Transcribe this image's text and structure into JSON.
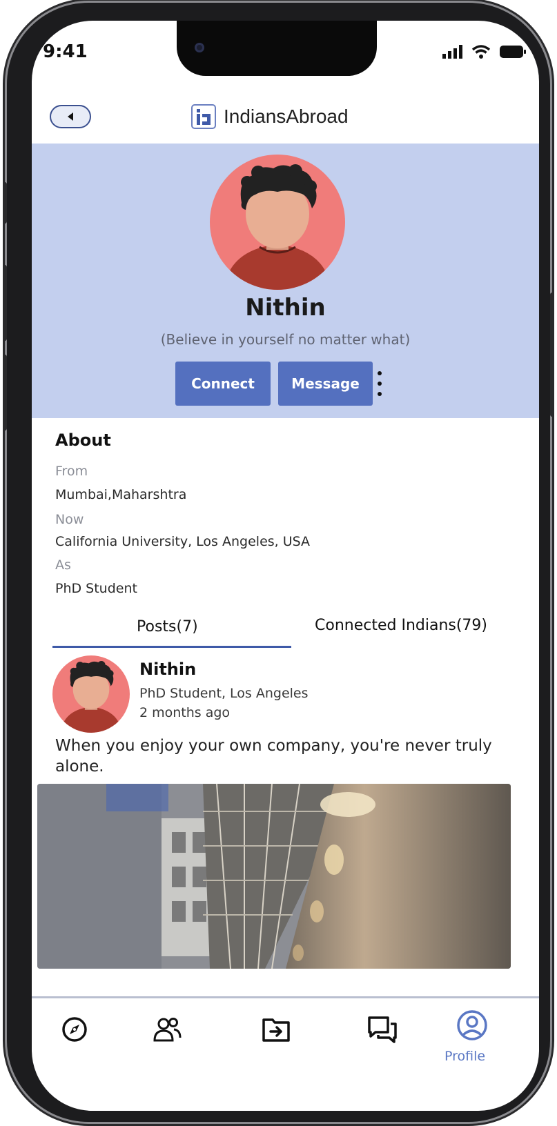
{
  "status_bar": {
    "time": "9:41"
  },
  "header": {
    "app_title": "IndiansAbroad"
  },
  "profile": {
    "name": "Nithin",
    "quote": "(Believe in yourself no matter what)",
    "connect_label": "Connect",
    "message_label": "Message"
  },
  "about": {
    "title": "About",
    "fields": [
      {
        "label": "From",
        "value": "Mumbai,Maharshtra"
      },
      {
        "label": "Now",
        "value": "California University, Los Angeles, USA"
      },
      {
        "label": "As",
        "value": "PhD Student"
      }
    ]
  },
  "tabs": [
    {
      "label": "Posts(7)",
      "active": true
    },
    {
      "label": "Connected Indians(79)",
      "active": false
    }
  ],
  "post": {
    "author": "Nithin",
    "subtitle": "PhD Student, Los Angeles",
    "time": "2 months ago",
    "text": "When you enjoy your own company, you're never truly alone."
  },
  "bottom_nav": {
    "items": [
      {
        "icon": "compass-icon",
        "label": ""
      },
      {
        "icon": "people-icon",
        "label": ""
      },
      {
        "icon": "folder-arrow-icon",
        "label": ""
      },
      {
        "icon": "chat-icon",
        "label": ""
      },
      {
        "icon": "profile-icon",
        "label": "Profile",
        "active": true
      }
    ]
  },
  "colors": {
    "accent": "#5470bf",
    "profile_bg": "#c3cfee",
    "avatar_bg": "#f07c7a",
    "active_nav": "#5a77c4"
  }
}
